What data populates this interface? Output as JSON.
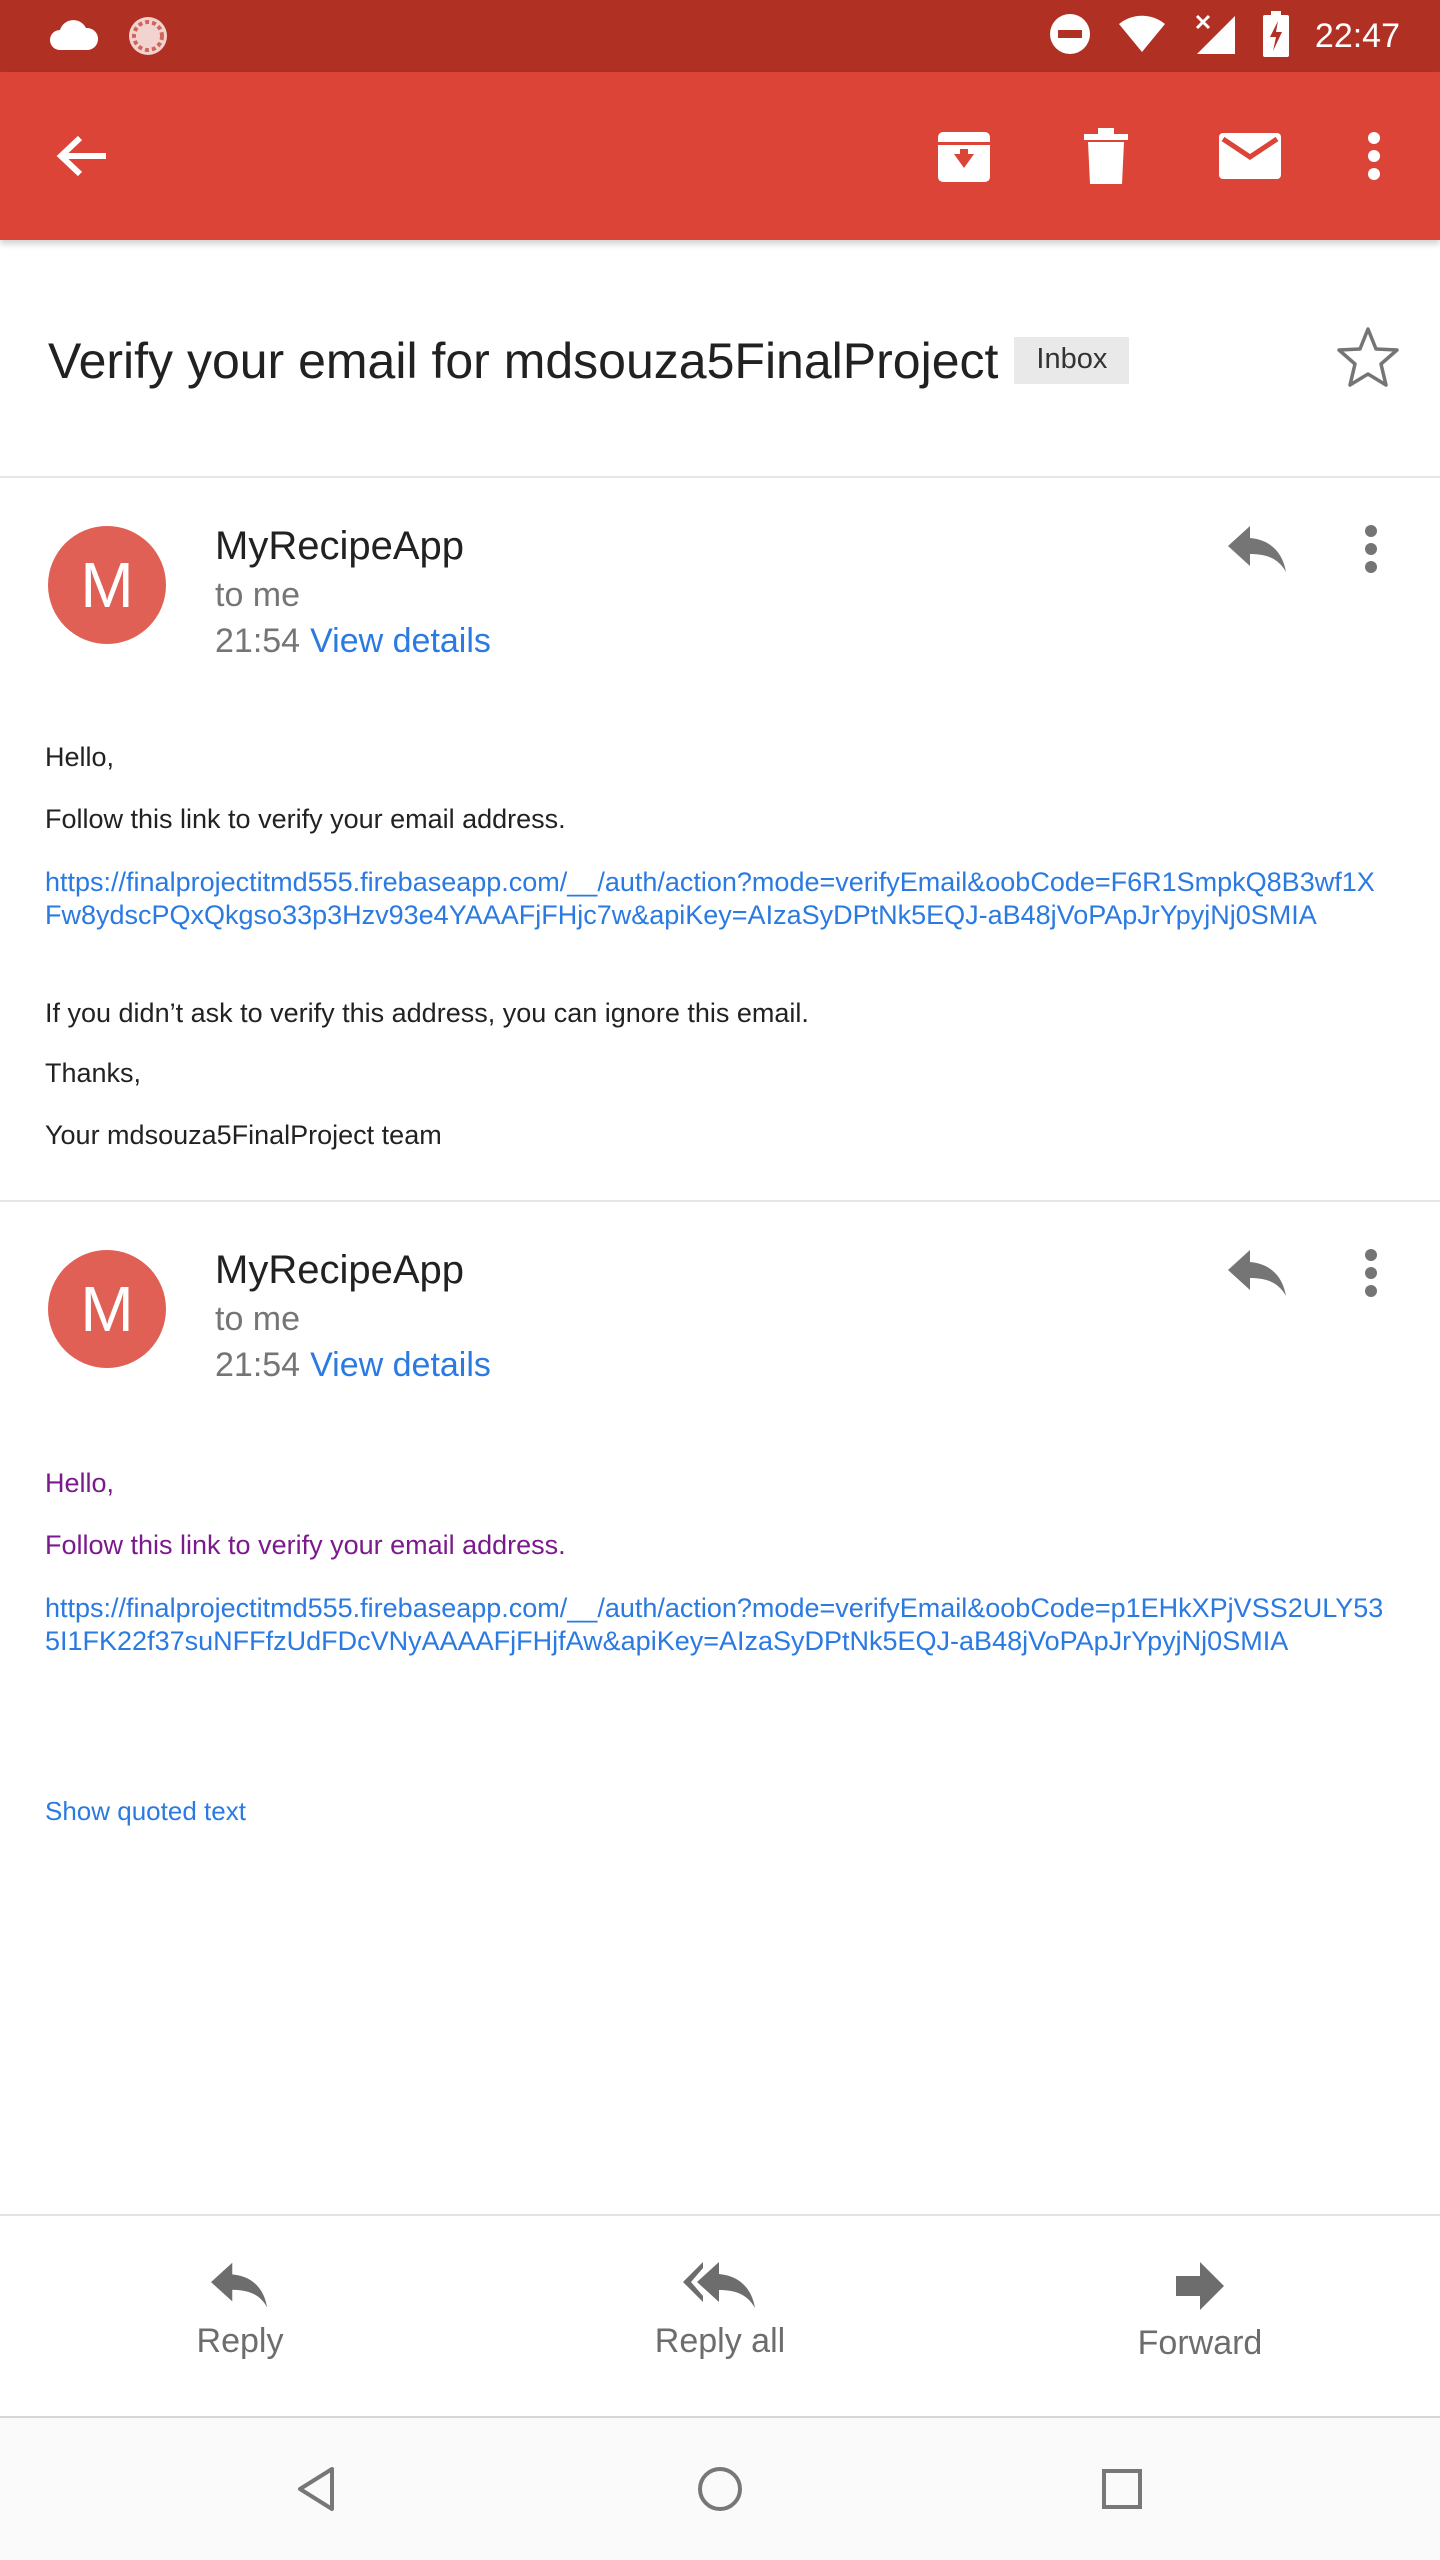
{
  "status_bar": {
    "time": "22:47"
  },
  "email": {
    "subject": "Verify your email for mdsouza5FinalProject",
    "label": "Inbox"
  },
  "messages": [
    {
      "avatar_letter": "M",
      "sender": "MyRecipeApp",
      "recipient": "to me",
      "time": "21:54",
      "view_details": "View details",
      "greeting": "Hello,",
      "instruction": "Follow this link to verify your email address.",
      "link": "https://finalprojectitmd555.firebaseapp.com/__/auth/action?mode=verifyEmail&oobCode=F6R1SmpkQ8B3wf1XFw8ydscPQxQkgso33p3Hzv93e4YAAAFjFHjc7w&apiKey=AIzaSyDPtNk5EQJ-aB48jVoPApJrYpyjNj0SMIA",
      "ignore_note": "If you didn’t ask to verify this address, you can ignore this email.",
      "thanks": "Thanks,",
      "signature": "Your mdsouza5FinalProject team"
    },
    {
      "avatar_letter": "M",
      "sender": "MyRecipeApp",
      "recipient": "to me",
      "time": "21:54",
      "view_details": "View details",
      "greeting": "Hello,",
      "instruction": "Follow this link to verify your email address.",
      "link": "https://finalprojectitmd555.firebaseapp.com/__/auth/action?mode=verifyEmail&oobCode=p1EHkXPjVSS2ULY535I1FK22f37suNFFfzUdFDcVNyAAAAFjFHjfAw&apiKey=AIzaSyDPtNk5EQJ-aB48jVoPApJrYpyjNj0SMIA",
      "show_quoted": "Show quoted text"
    }
  ],
  "actions": {
    "reply": "Reply",
    "reply_all": "Reply all",
    "forward": "Forward"
  },
  "colors": {
    "status_bar": "#b03024",
    "app_bar": "#db4437",
    "avatar": "#e06055",
    "link": "#2a7ae2",
    "quoted_text": "#7b1a8c"
  },
  "icons": {
    "status_left": [
      "cloud-icon",
      "sync-icon"
    ],
    "status_right": [
      "do-not-disturb-icon",
      "wifi-icon",
      "signal-icon",
      "battery-charging-icon"
    ],
    "app_bar": [
      "back-arrow-icon",
      "archive-icon",
      "delete-icon",
      "mark-unread-icon",
      "overflow-menu-icon"
    ],
    "nav": [
      "nav-back-icon",
      "nav-home-icon",
      "nav-recents-icon"
    ]
  }
}
